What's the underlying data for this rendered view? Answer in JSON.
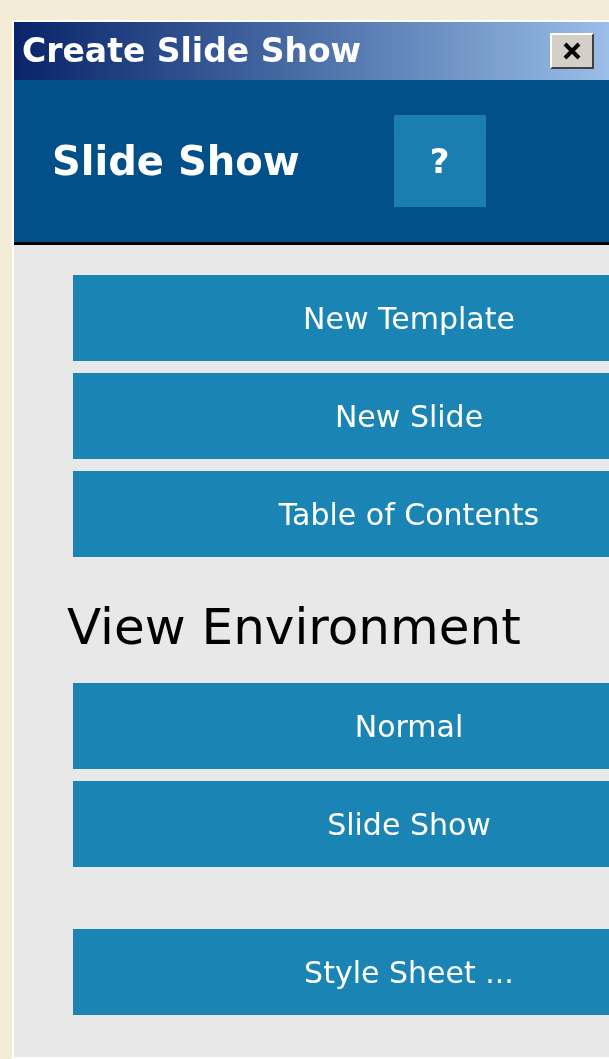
{
  "window": {
    "title": "Create Slide Show"
  },
  "header": {
    "title": "Slide Show",
    "help_button": "?"
  },
  "create_buttons": [
    "New Template",
    "New Slide",
    "Table of Contents"
  ],
  "view_section": {
    "heading": "View Environment",
    "buttons": [
      "Normal",
      "Slide Show"
    ]
  },
  "style_button": "Style Sheet ..."
}
